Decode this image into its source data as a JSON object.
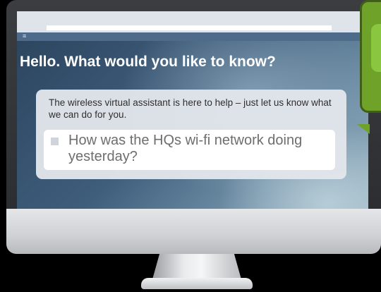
{
  "assistant": {
    "headline": "Hello. What would you like to know?",
    "intro": "The wireless virtual assistant is here to help – just let us know what we can do for you.",
    "query": "How was the HQs wi-fi network doing yesterday?"
  },
  "icons": {
    "menu": "hamburger-menu-icon"
  },
  "colors": {
    "accent_green": "#6ea229",
    "menu_bar": "#4f6b8c"
  }
}
